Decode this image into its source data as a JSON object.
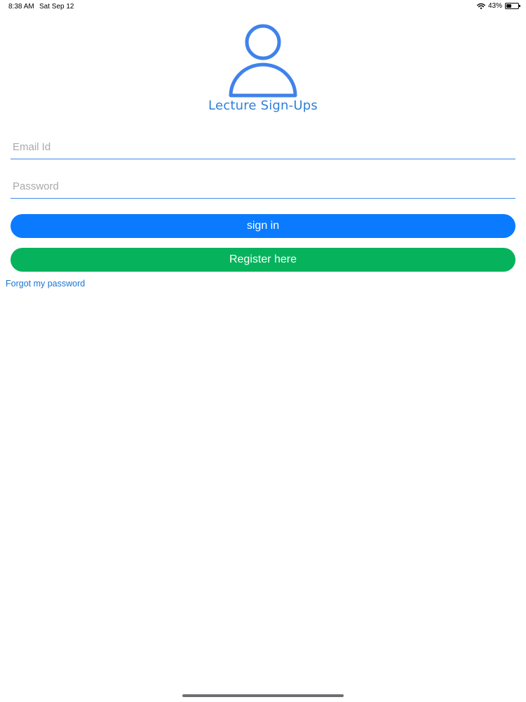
{
  "status_bar": {
    "time": "8:38 AM",
    "date": "Sat Sep 12",
    "battery_percent_label": "43%",
    "battery_level": 0.43,
    "wifi_icon": "wifi-icon",
    "battery_icon": "battery-icon"
  },
  "header": {
    "logo_icon": "user-icon",
    "title": "Lecture Sign-Ups"
  },
  "form": {
    "email_placeholder": "Email Id",
    "email_value": "",
    "password_placeholder": "Password",
    "password_value": "",
    "sign_in_label": "sign in",
    "register_label": "Register here",
    "forgot_label": "Forgot my password"
  },
  "colors": {
    "accent_blue": "#0a7bff",
    "register_green": "#06b35c",
    "title_blue": "#2f80d8",
    "icon_blue": "#3f82eb",
    "link_blue": "#1a73d4"
  }
}
